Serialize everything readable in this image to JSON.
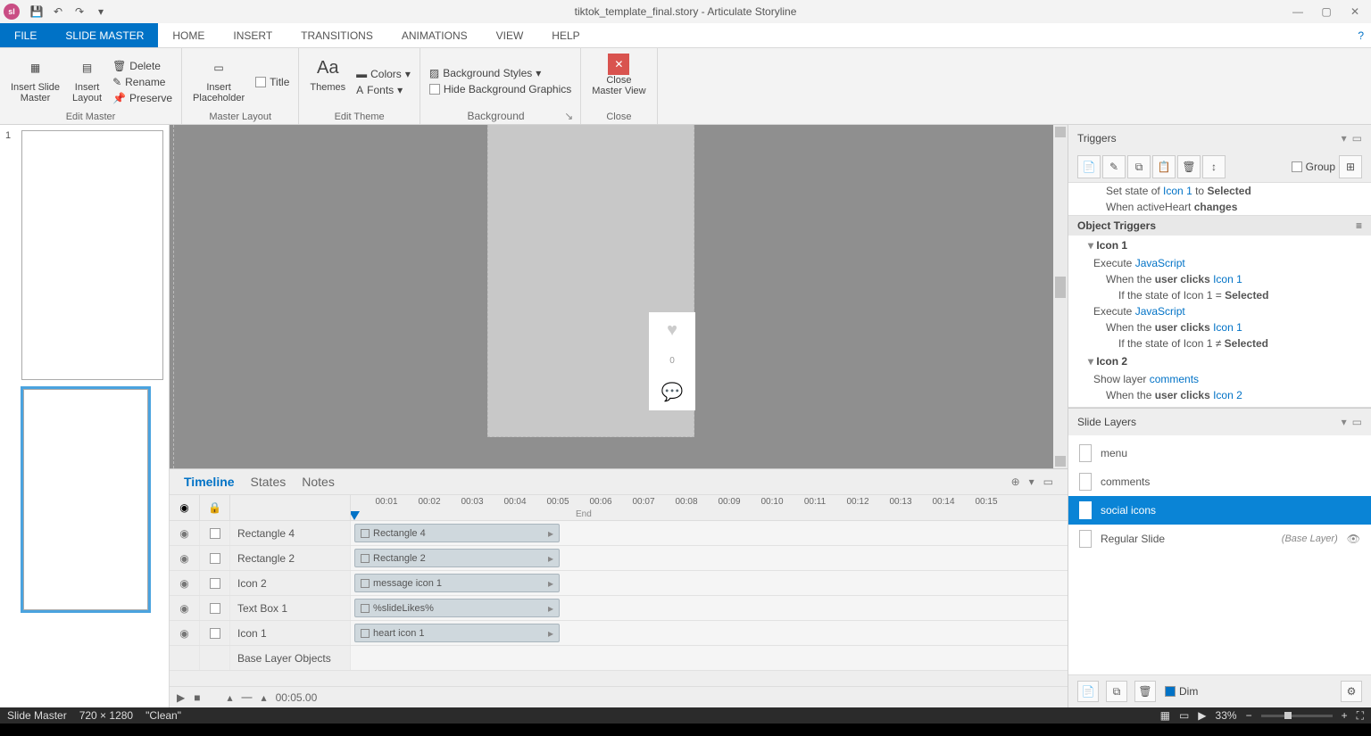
{
  "titlebar": {
    "app_initials": "sl",
    "title": "tiktok_template_final.story - Articulate Storyline"
  },
  "menus": {
    "file": "FILE",
    "slide_master": "SLIDE MASTER",
    "home": "HOME",
    "insert": "INSERT",
    "transitions": "TRANSITIONS",
    "animations": "ANIMATIONS",
    "view": "VIEW",
    "help": "HELP"
  },
  "ribbon": {
    "insert_slide_master": "Insert Slide\nMaster",
    "insert_layout": "Insert\nLayout",
    "delete": "Delete",
    "rename": "Rename",
    "preserve": "Preserve",
    "edit_master": "Edit Master",
    "insert_placeholder": "Insert\nPlaceholder",
    "title": "Title",
    "master_layout": "Master Layout",
    "themes": "Themes",
    "colors": "Colors",
    "fonts": "Fonts",
    "edit_theme": "Edit Theme",
    "background_styles": "Background Styles",
    "hide_bg": "Hide Background Graphics",
    "background": "Background",
    "close_master": "Close\nMaster View",
    "close": "Close"
  },
  "slidenav": {
    "num1": "1"
  },
  "timeline": {
    "tabs": {
      "timeline": "Timeline",
      "states": "States",
      "notes": "Notes"
    },
    "ticks": [
      "00:01",
      "00:02",
      "00:03",
      "00:04",
      "00:05",
      "00:06",
      "00:07",
      "00:08",
      "00:09",
      "00:10",
      "00:11",
      "00:12",
      "00:13",
      "00:14",
      "00:15"
    ],
    "end_label": "End",
    "rows": [
      {
        "name": "Rectangle 4",
        "clip": "Rectangle 4"
      },
      {
        "name": "Rectangle 2",
        "clip": "Rectangle 2"
      },
      {
        "name": "Icon 2",
        "clip": "message icon 1"
      },
      {
        "name": "Text Box 1",
        "clip": "%slideLikes%"
      },
      {
        "name": "Icon 1",
        "clip": "heart icon 1"
      }
    ],
    "base_label": "Base Layer Objects",
    "duration": "00:05.00"
  },
  "triggers": {
    "panel_title": "Triggers",
    "group_label": "Group",
    "set_state_pre": "Set state of ",
    "icon1": "Icon 1",
    "to": " to ",
    "selected": "Selected",
    "when_var": "When activeHeart ",
    "changes": "changes",
    "object_triggers": "Object Triggers",
    "obj_icon1": "Icon 1",
    "exec_js": "Execute ",
    "js": "JavaScript",
    "when_user_clicks": "When the ",
    "user_clicks": "user clicks ",
    "if_state": "If the state of Icon 1 = ",
    "if_state_neq": "If the state of Icon 1 ≠ ",
    "obj_icon2": "Icon 2",
    "show_layer": "Show layer ",
    "comments": "comments",
    "icon2": "Icon 2"
  },
  "layers": {
    "panel_title": "Slide Layers",
    "items": [
      {
        "name": "menu"
      },
      {
        "name": "comments"
      },
      {
        "name": "social icons"
      },
      {
        "name": "Regular Slide",
        "meta": "(Base Layer)"
      }
    ],
    "dim": "Dim"
  },
  "status": {
    "mode": "Slide Master",
    "dims": "720 × 1280",
    "layout": "\"Clean\"",
    "zoom": "33%"
  }
}
